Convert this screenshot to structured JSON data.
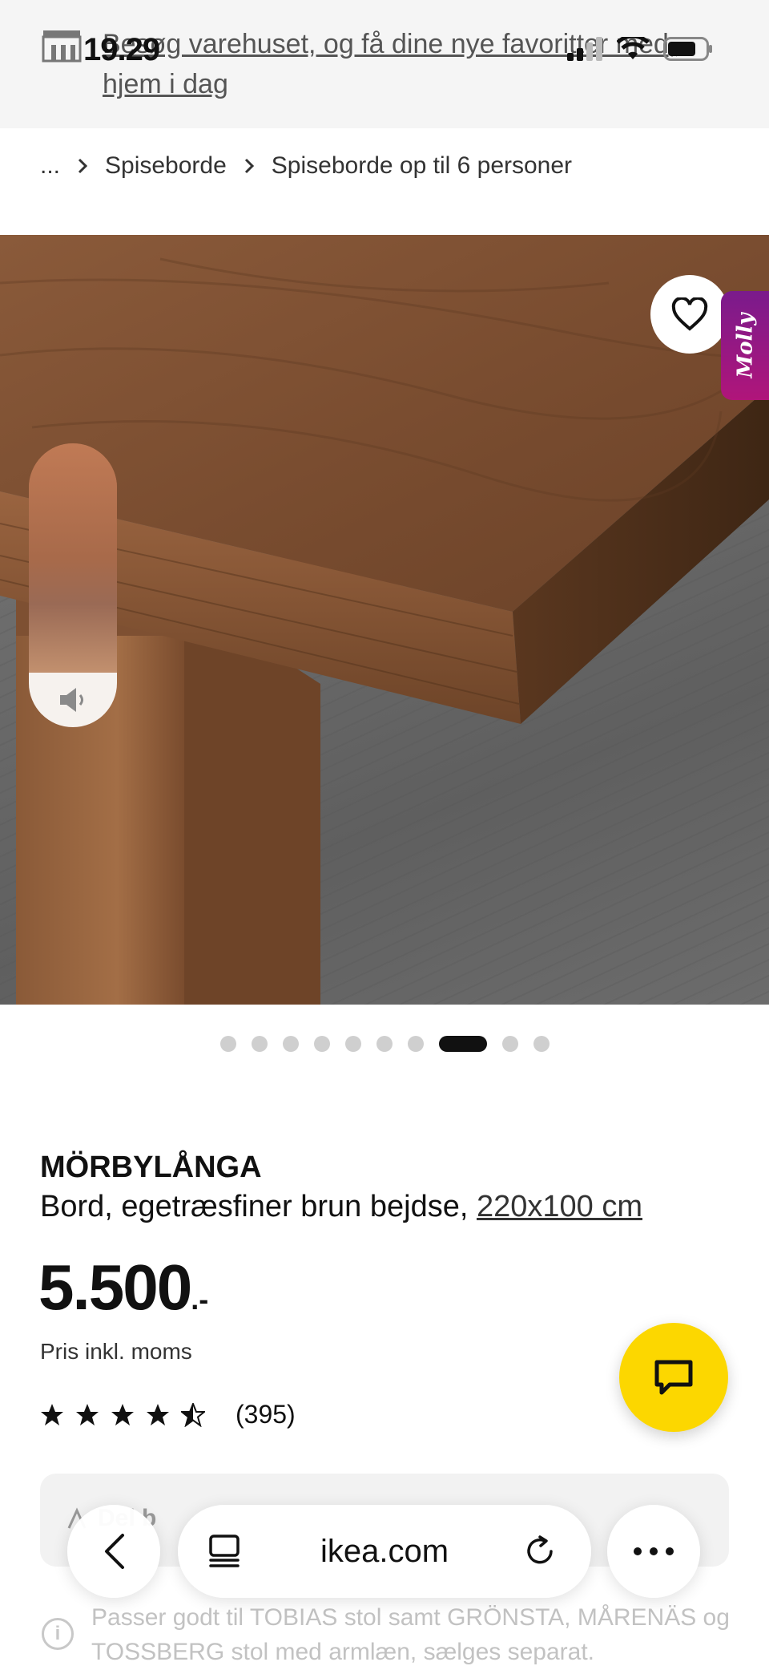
{
  "status_bar": {
    "time": "19.29"
  },
  "banner": {
    "text": "Besøg varehuset, og få dine nye favoritter med, hjem i dag"
  },
  "breadcrumb": {
    "ellipsis": "...",
    "items": [
      "Spiseborde",
      "Spiseborde op til 6 personer"
    ]
  },
  "hero": {
    "molly_label": "Molly",
    "gallery_count": 10,
    "active_index": 7
  },
  "product": {
    "name": "MÖRBYLÅNGA",
    "description": "Bord, egetræsfiner brun bejdse,",
    "size": "220x100 cm",
    "price": "5.500",
    "price_suffix": ".-",
    "price_note": "Pris inkl. moms",
    "rating_stars": 4.5,
    "rating_count": "(395)"
  },
  "share": {
    "label": "Del b"
  },
  "note": {
    "text": "Passer godt til TOBIAS stol samt GRÖNSTA, MÅRENÄS og TOSSBERG stol med armlæn, sælges separat."
  },
  "browser": {
    "url": "ikea.com"
  },
  "colors": {
    "chat_button": "#fcd700",
    "molly_gradient_top": "#7a1b8c",
    "molly_gradient_bottom": "#b0157a",
    "active_dot": "#111111"
  },
  "icons": [
    "store-icon",
    "signal-icon",
    "wifi-icon",
    "battery-icon",
    "chevron-right-icon",
    "heart-icon",
    "speaker-icon",
    "star-icon",
    "chat-icon",
    "share-icon",
    "info-icon",
    "back-icon",
    "tabs-icon",
    "reload-icon",
    "more-icon"
  ]
}
